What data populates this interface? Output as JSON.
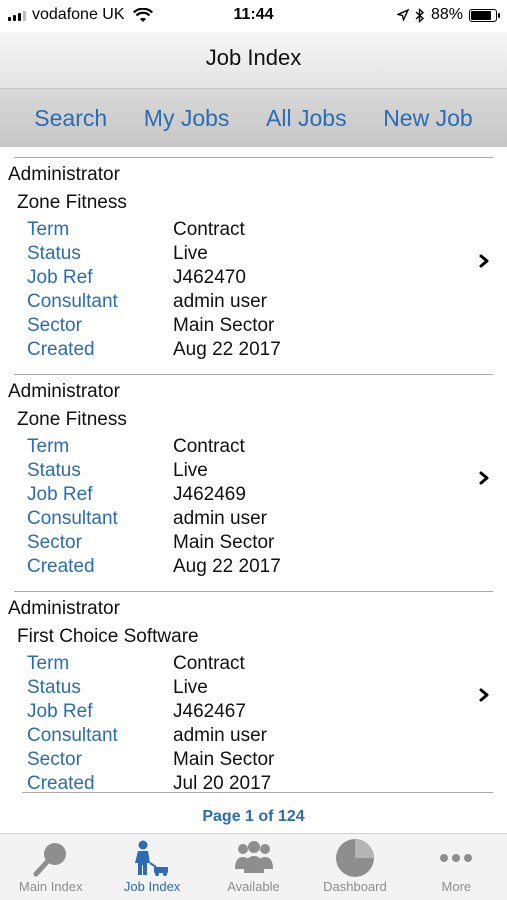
{
  "status_bar": {
    "carrier": "vodafone UK",
    "time": "11:44",
    "battery": "88%",
    "battery_level": 0.88
  },
  "title": "Job Index",
  "nav": [
    "Search",
    "My Jobs",
    "All Jobs",
    "New Job"
  ],
  "jobs": [
    {
      "owner": "Administrator",
      "company": "Zone Fitness",
      "fields": [
        {
          "k": "Term",
          "v": "Contract"
        },
        {
          "k": "Status",
          "v": "Live"
        },
        {
          "k": "Job Ref",
          "v": "J462470"
        },
        {
          "k": "Consultant",
          "v": "admin user"
        },
        {
          "k": "Sector",
          "v": "Main Sector"
        },
        {
          "k": "Created",
          "v": "Aug 22 2017"
        }
      ]
    },
    {
      "owner": "Administrator",
      "company": "Zone Fitness",
      "fields": [
        {
          "k": "Term",
          "v": "Contract"
        },
        {
          "k": "Status",
          "v": "Live"
        },
        {
          "k": "Job Ref",
          "v": "J462469"
        },
        {
          "k": "Consultant",
          "v": "admin user"
        },
        {
          "k": "Sector",
          "v": "Main Sector"
        },
        {
          "k": "Created",
          "v": "Aug 22 2017"
        }
      ]
    },
    {
      "owner": "Administrator",
      "company": "First Choice Software",
      "fields": [
        {
          "k": "Term",
          "v": "Contract"
        },
        {
          "k": "Status",
          "v": "Live"
        },
        {
          "k": "Job Ref",
          "v": "J462467"
        },
        {
          "k": "Consultant",
          "v": "admin user"
        },
        {
          "k": "Sector",
          "v": "Main Sector"
        },
        {
          "k": "Created",
          "v": "Jul 20 2017"
        }
      ]
    }
  ],
  "pager": "Page 1 of 124",
  "tabs": [
    {
      "label": "Main Index",
      "icon": "magnifier-icon",
      "active": false
    },
    {
      "label": "Job Index",
      "icon": "worker-icon",
      "active": true
    },
    {
      "label": "Available",
      "icon": "people-group-icon",
      "active": false
    },
    {
      "label": "Dashboard",
      "icon": "pie-chart-icon",
      "active": false
    },
    {
      "label": "More",
      "icon": "ellipsis-icon",
      "active": false
    }
  ],
  "colors": {
    "accent": "#2b6cb4",
    "inactive": "#8e8e8e"
  }
}
